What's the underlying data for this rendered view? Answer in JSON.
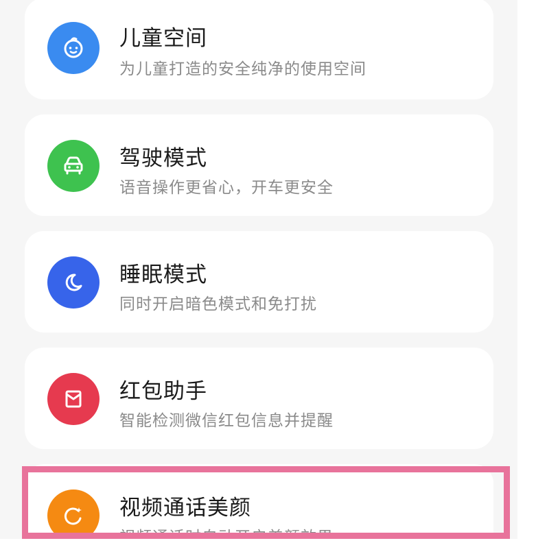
{
  "colors": {
    "kids_space": "#3a8bf0",
    "driving_mode": "#3ec24f",
    "sleep_mode": "#3764ea",
    "red_packet": "#e63a4f",
    "video_beauty": "#f58a12",
    "highlight_border": "#e8739b"
  },
  "cards": [
    {
      "title": "儿童空间",
      "subtitle": "为儿童打造的安全纯净的使用空间",
      "icon": "baby-face-icon"
    },
    {
      "title": "驾驶模式",
      "subtitle": "语音操作更省心，开车更安全",
      "icon": "car-icon"
    },
    {
      "title": "睡眠模式",
      "subtitle": "同时开启暗色模式和免打扰",
      "icon": "moon-icon"
    },
    {
      "title": "红包助手",
      "subtitle": "智能检测微信红包信息并提醒",
      "icon": "envelope-icon"
    },
    {
      "title": "视频通话美颜",
      "subtitle": "视频通话时自动开启美颜效果",
      "icon": "beauty-sparkle-icon"
    }
  ]
}
